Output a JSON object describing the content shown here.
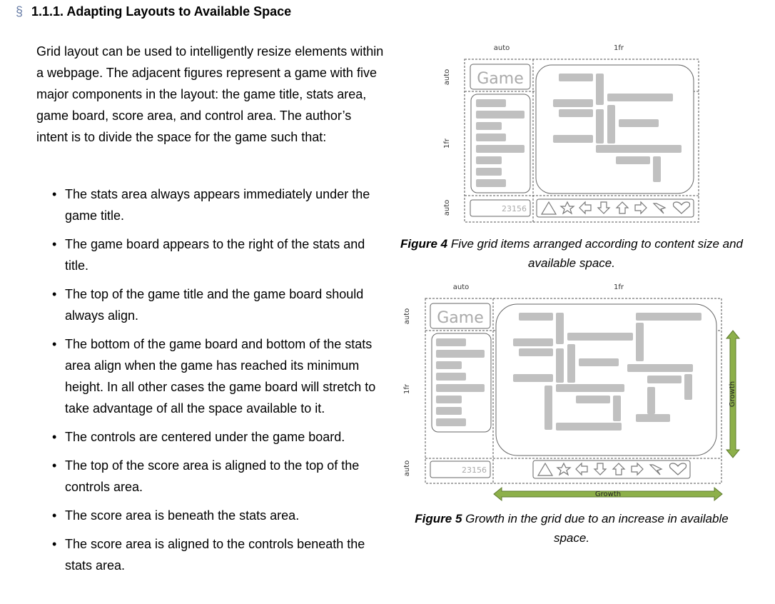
{
  "section": {
    "marker": "§",
    "title": "1.1.1. Adapting Layouts to Available Space"
  },
  "intro": "Grid layout can be used to intelligently resize elements within a webpage. The adjacent figures represent a game with five major components in the layout: the game title, stats area, game board, score area, and control area. The author’s intent is to divide the space for the game such that:",
  "bullets": [
    "The stats area always appears immediately under the game title.",
    "The game board appears to the right of the stats and title.",
    "The top of the game title and the game board should always align.",
    "The bottom of the game board and bottom of the stats area align when the game has reached its minimum height. In all other cases the game board will stretch to take advantage of all the space available to it.",
    "The controls are centered under the game board.",
    "The top of the score area is aligned to the top of the controls area.",
    "The score area is beneath the stats area.",
    "The score area is aligned to the controls beneath the stats area."
  ],
  "figure4": {
    "col_labels": [
      "auto",
      "1fr"
    ],
    "row_labels": [
      "auto",
      "1fr",
      "auto"
    ],
    "title_text": "Game",
    "score_text": "23156",
    "caption_label": "Figure 4",
    "caption_text": " Five grid items arranged according to content size and available space."
  },
  "figure5": {
    "col_labels": [
      "auto",
      "1fr"
    ],
    "row_labels": [
      "auto",
      "1fr",
      "auto"
    ],
    "title_text": "Game",
    "score_text": "23156",
    "growth_vertical": "Growth",
    "growth_horizontal": "Growth",
    "caption_label": "Figure 5",
    "caption_text": " Growth in the grid due to an increase in available space."
  },
  "colors": {
    "placeholder_bar": "#c0c0c0",
    "growth_arrow": "#8db04a",
    "section_marker": "#6a7fa8"
  }
}
